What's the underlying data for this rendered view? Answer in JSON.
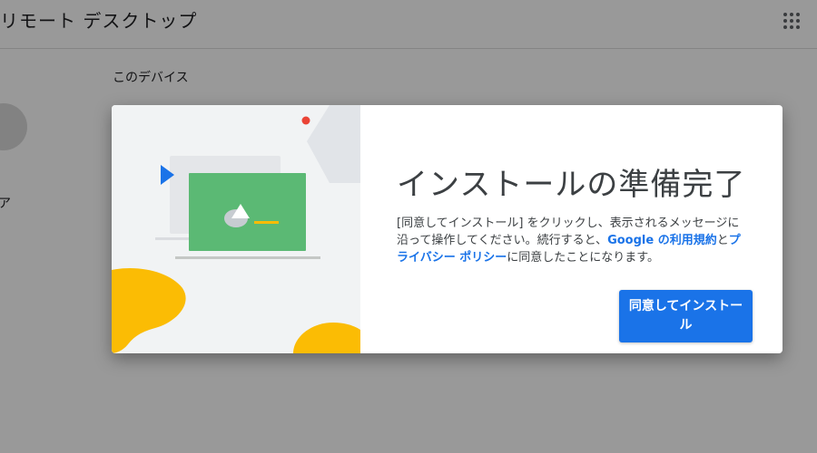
{
  "app": {
    "title": "リモート デスクトップ"
  },
  "sidebar": {
    "partial_label": "ア"
  },
  "main": {
    "section_title": "このデバイス"
  },
  "dialog": {
    "title": "インストールの準備完了",
    "body_prefix": "[同意してインストール] をクリックし、表示されるメッセージに沿って操作してください。続行すると、",
    "terms_link": "Google の利用規約",
    "body_conj": "と",
    "privacy_link": "プライバシー ポリシー",
    "body_suffix": "に同意したことになります。",
    "accept_button": "同意してインストール"
  },
  "colors": {
    "accent": "#1a73e8",
    "illustration_bg": "#f1f3f4",
    "monitor_green": "#5bb974",
    "blob_yellow": "#fbbc04",
    "play_blue": "#1a73e8",
    "dot_red": "#ea4335"
  },
  "icons": {
    "apps": "apps-grid-icon",
    "play": "play-triangle-icon"
  }
}
